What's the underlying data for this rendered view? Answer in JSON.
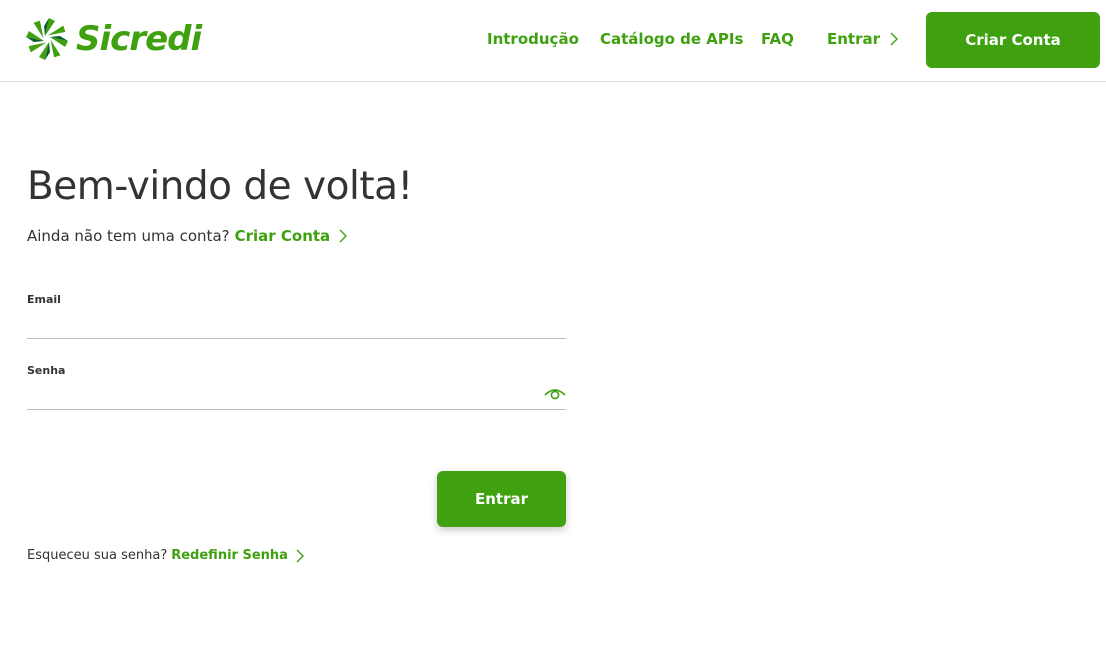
{
  "brand": {
    "name": "Sicredi",
    "color": "#3fa110"
  },
  "nav": {
    "items": [
      "Introdução",
      "Catálogo de APIs",
      "FAQ"
    ],
    "login_label": "Entrar",
    "signup_button": "Criar Conta"
  },
  "login": {
    "title": "Bem-vindo de volta!",
    "no_account_text": "Ainda não tem uma conta?",
    "create_account_link": "Criar Conta",
    "email_label": "Email",
    "email_value": "",
    "password_label": "Senha",
    "password_value": "",
    "password_toggle_icon": "eye-icon",
    "submit_label": "Entrar",
    "forgot_text": "Esqueceu sua senha?",
    "reset_link": "Redefinir Senha"
  }
}
